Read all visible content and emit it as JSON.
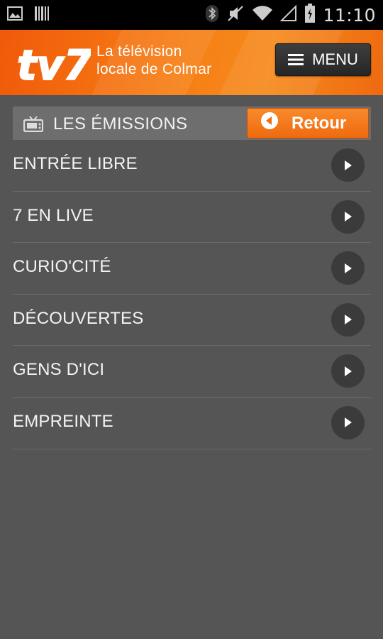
{
  "status_bar": {
    "time": "11:10",
    "icons": [
      "image-icon",
      "barcode-icon",
      "bluetooth-icon",
      "mute-icon",
      "wifi-icon",
      "signal-icon",
      "battery-icon"
    ]
  },
  "header": {
    "logo_text": "tv7",
    "tagline_line1": "La télévision",
    "tagline_line2": "locale de Colmar",
    "menu_label": "MENU"
  },
  "section": {
    "title": "LES ÉMISSIONS",
    "back_label": "Retour"
  },
  "list": {
    "items": [
      {
        "label": "ENTRÉE LIBRE"
      },
      {
        "label": "7 EN LIVE"
      },
      {
        "label": "CURIO'CITÉ"
      },
      {
        "label": "DÉCOUVERTES"
      },
      {
        "label": "GENS D'ICI"
      },
      {
        "label": "EMPREINTE"
      }
    ]
  },
  "colors": {
    "brand_orange": "#f47a14",
    "background": "#555555",
    "section_bar": "#6e6e6e"
  }
}
